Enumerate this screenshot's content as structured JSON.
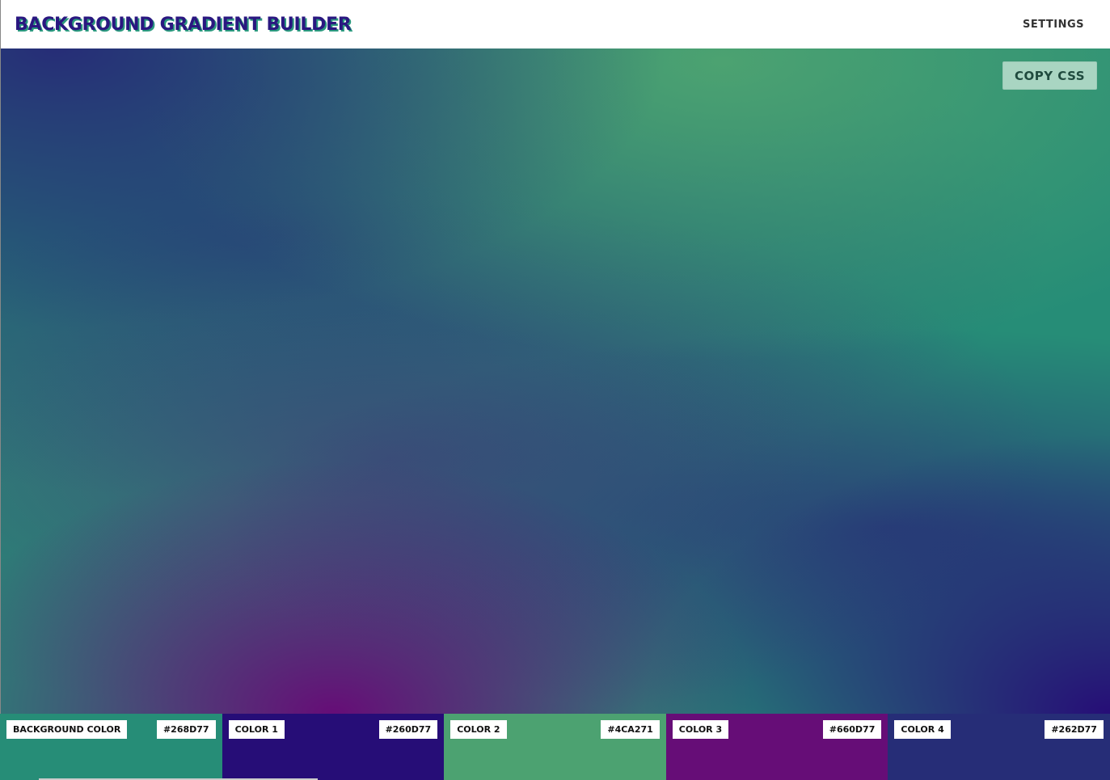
{
  "header": {
    "title": "BACKGROUND GRADIENT BUILDER",
    "settings_label": "SETTINGS"
  },
  "canvas": {
    "copy_label": "COPY CSS"
  },
  "swatches": [
    {
      "label": "BACKGROUND COLOR",
      "hex": "#268D77",
      "color": "#268D77"
    },
    {
      "label": "COLOR 1",
      "hex": "#260D77",
      "color": "#260D77"
    },
    {
      "label": "COLOR 2",
      "hex": "#4CA271",
      "color": "#4CA271"
    },
    {
      "label": "COLOR 3",
      "hex": "#660D77",
      "color": "#660D77"
    },
    {
      "label": "COLOR 4",
      "hex": "#262D77",
      "color": "#262D77"
    }
  ],
  "colors": {
    "title_text": "#2a1780",
    "title_shadow": "#2b9a7f",
    "copy_button_bg": "#a9d5c2"
  }
}
